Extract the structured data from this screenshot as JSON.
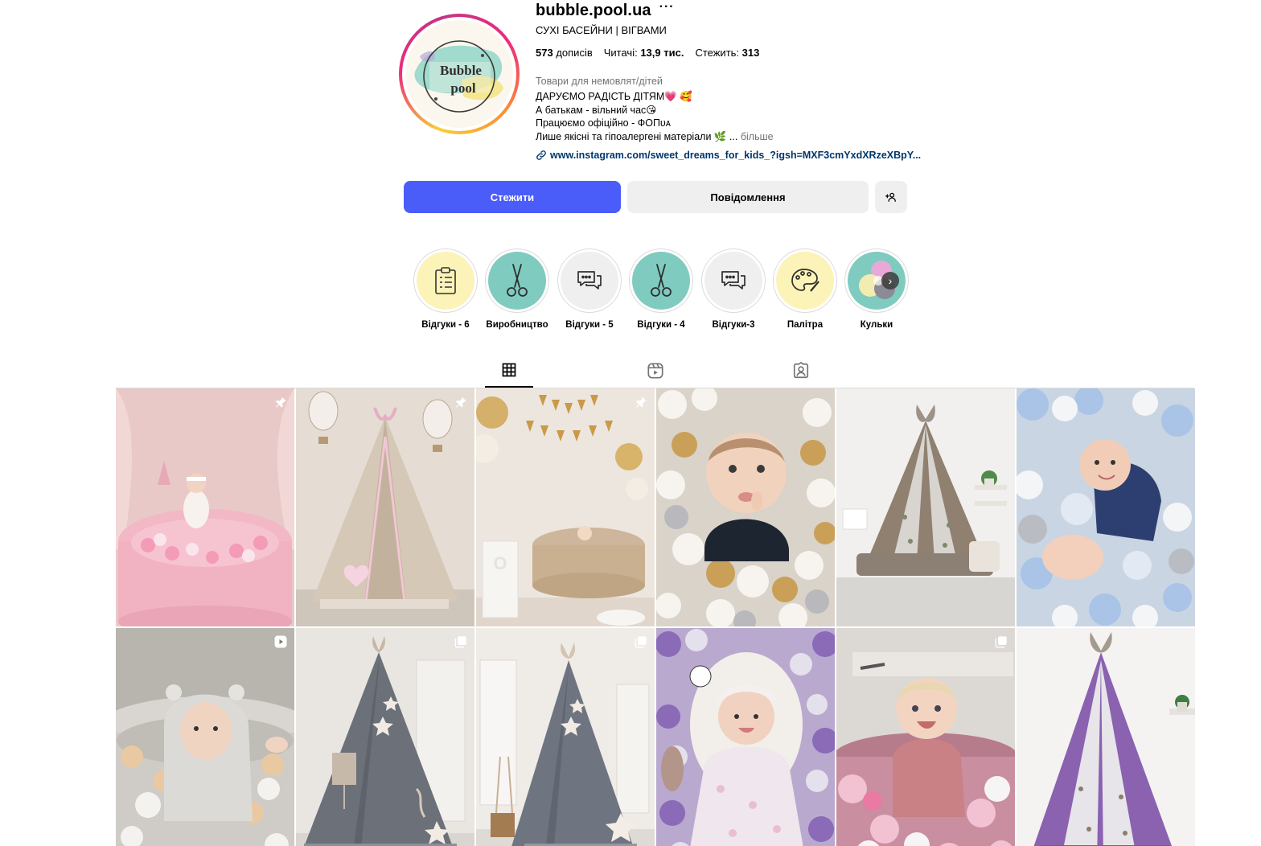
{
  "profile": {
    "username": "bubble.pool.ua",
    "more_label": "···",
    "full_name": "СУХІ БАСЕЙНИ | ВІГВАМИ",
    "avatar_text_top": "Bubble",
    "avatar_text_bottom": "pool",
    "stats": {
      "posts_value": "573",
      "posts_label": "дописів",
      "followers_label": "Читачі:",
      "followers_value": "13,9 тис.",
      "following_label": "Стежить:",
      "following_value": "313"
    },
    "category": "Товари для немовлят/дітей",
    "bio_lines": [
      "ДАРУЄМО РАДІСТЬ ДІТЯМ💗 🥰",
      "А батькам - вільний час😘",
      "Працюємо офіційно - ФОПᴜᴀ",
      "Лише якісні та гіпоалергені матеріали 🌿 ..."
    ],
    "bio_more": "більше",
    "link": "www.instagram.com/sweet_dreams_for_kids_?igsh=MXF3cmYxdXRzeXBpY..."
  },
  "actions": {
    "follow": "Стежити",
    "message": "Повідомлення"
  },
  "highlights": [
    {
      "label": "Відгуки - 6",
      "bg": "#fcf3b8",
      "icon": "clipboard-icon"
    },
    {
      "label": "Виробництво",
      "bg": "#7fcbc0",
      "icon": "scissors-icon"
    },
    {
      "label": "Відгуки - 5",
      "bg": "#efefef",
      "icon": "chat-bubbles-icon"
    },
    {
      "label": "Відгуки - 4",
      "bg": "#7fcbc0",
      "icon": "scissors-icon"
    },
    {
      "label": "Відгуки-3",
      "bg": "#efefef",
      "icon": "chat-bubbles-icon"
    },
    {
      "label": "Палітра",
      "bg": "#fcf3b8",
      "icon": "palette-icon"
    },
    {
      "label": "Кульки",
      "bg": "#7fcbc0",
      "icon": "balls-icon"
    }
  ],
  "tabs": [
    "grid-icon",
    "reels-icon",
    "tagged-icon"
  ],
  "posts": [
    {
      "subject": "pink-ball-pit-baby",
      "badge": "pin-icon"
    },
    {
      "subject": "beige-teepee-balloons",
      "badge": "pin-icon"
    },
    {
      "subject": "birthday-ball-pit",
      "badge": "pin-icon"
    },
    {
      "subject": "baby-in-pearl-balls",
      "badge": ""
    },
    {
      "subject": "floral-teepee",
      "badge": ""
    },
    {
      "subject": "baby-in-blue-balls",
      "badge": ""
    },
    {
      "subject": "baby-grey-ball-pit",
      "badge": "reel-icon"
    },
    {
      "subject": "grey-teepee-stars",
      "badge": "carousel-icon"
    },
    {
      "subject": "grey-teepee-room",
      "badge": "carousel-icon"
    },
    {
      "subject": "baby-lilac-balls",
      "badge": ""
    },
    {
      "subject": "baby-pink-ball-pit",
      "badge": "carousel-icon"
    },
    {
      "subject": "lilac-floral-teepee",
      "badge": ""
    }
  ],
  "colors": {
    "follow_button": "#4a5df9",
    "secondary_button": "#efefef",
    "link": "#00376b",
    "muted": "#737373"
  }
}
